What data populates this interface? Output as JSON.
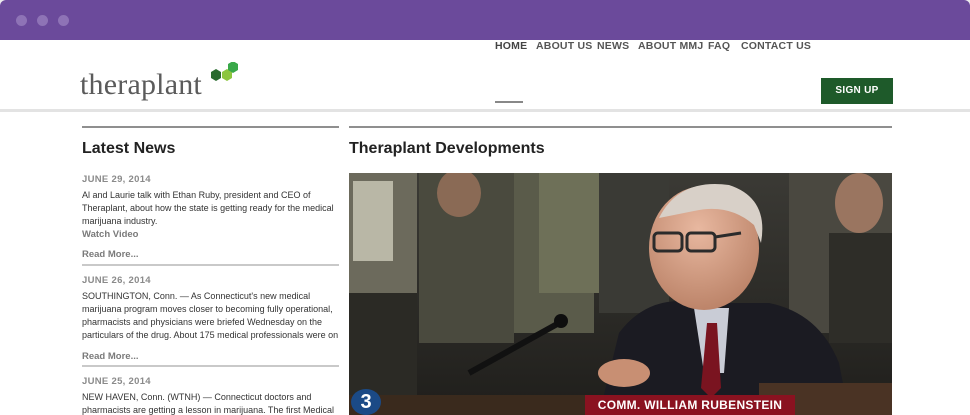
{
  "brand": {
    "name": "theraplant",
    "accent": "#1e5a2a",
    "mark_colors": [
      "#2a6b2f",
      "#39a849",
      "#8cc63f"
    ]
  },
  "nav": {
    "items": [
      {
        "label": "HOME",
        "active": true
      },
      {
        "label": "ABOUT US"
      },
      {
        "label": "NEWS"
      },
      {
        "label": "ABOUT MMJ"
      },
      {
        "label": "FAQ"
      },
      {
        "label": "CONTACT US"
      }
    ],
    "signup_label": "SIGN UP"
  },
  "latest_news": {
    "title": "Latest News",
    "items": [
      {
        "date": "JUNE 29, 2014",
        "body": "Al and Laurie talk with Ethan Ruby, president and CEO of Theraplant, about how the state is getting ready for the medical marijuana industry.",
        "extra_link": "Watch Video",
        "more": "Read More..."
      },
      {
        "date": "JUNE 26, 2014",
        "body": "SOUTHINGTON, Conn. — As Connecticut's new medical marijuana program moves closer to becoming fully operational, pharmacists and physicians were briefed Wednesday on the particulars of the drug. About 175 medical professionals were on",
        "more": "Read More..."
      },
      {
        "date": "JUNE 25, 2014",
        "body": "NEW HAVEN, Conn. (WTNH) — Connecticut doctors and pharmacists are getting a lesson in marijuana. The first Medical"
      }
    ]
  },
  "developments": {
    "title": "Theraplant Developments",
    "video": {
      "channel_badge": "3",
      "caption": "COMM. WILLIAM RUBENSTEIN"
    }
  }
}
